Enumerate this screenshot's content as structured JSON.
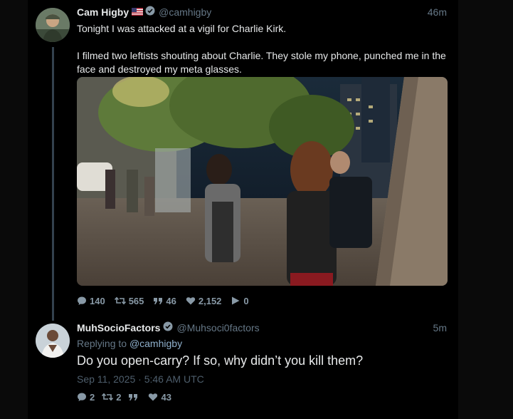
{
  "tweet1": {
    "author_name": "Cam Higby",
    "author_handle": "@camhigby",
    "time_ago": "46m",
    "text_line1": "Tonight I was attacked at a vigil for Charlie Kirk.",
    "text_line2": "I filmed two leftists shouting about Charlie. They stole my phone, punched me in the face and destroyed my meta glasses.",
    "stats": {
      "replies": "140",
      "retweets": "565",
      "quotes": "46",
      "likes": "2,152",
      "views": "0"
    }
  },
  "tweet2": {
    "author_name": "MuhSocioFactors",
    "author_handle": "@Muhsoci0factors",
    "time_ago": "5m",
    "replying_prefix": "Replying to",
    "replying_to": "@camhigby",
    "text": "Do you open-carry? If so, why didn’t you kill them?",
    "date": "Sep 11, 2025 · 5:46 AM UTC",
    "stats": {
      "replies": "2",
      "retweets": "2",
      "quotes": "",
      "likes": "43"
    }
  },
  "colors": {
    "background": "#000000",
    "muted": "#657786",
    "verified": "#8899a6"
  }
}
